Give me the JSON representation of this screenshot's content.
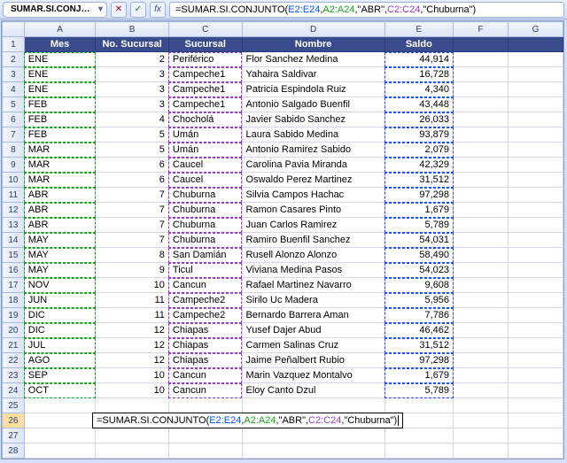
{
  "namebox": {
    "value": "SUMAR.SI.CONJ…",
    "dropdown_glyph": "▾"
  },
  "fx_buttons": {
    "cancel": "✕",
    "ok": "✓",
    "fx": "fx"
  },
  "formula": {
    "prefix": "=SUMAR.SI.CONJUNTO(",
    "r1": "E2:E24",
    "c1": ",",
    "r2": "A2:A24",
    "c2": ",\"ABR\",",
    "r3": "C2:C24",
    "c3": ",\"Chuburna\")"
  },
  "columns": [
    "",
    "A",
    "B",
    "C",
    "D",
    "E",
    "F",
    "G"
  ],
  "header_row": {
    "num": "1",
    "mes": "Mes",
    "no": "No. Sucursal",
    "suc": "Sucursal",
    "nom": "Nombre",
    "saldo": "Saldo"
  },
  "rows": [
    {
      "n": "2",
      "mes": "ENE",
      "no": "2",
      "suc": "Periférico",
      "nom": "Flor Sanchez Medina",
      "saldo": "44,914"
    },
    {
      "n": "3",
      "mes": "ENE",
      "no": "3",
      "suc": "Campeche1",
      "nom": "Yahaira Saldivar",
      "saldo": "16,728"
    },
    {
      "n": "4",
      "mes": "ENE",
      "no": "3",
      "suc": "Campeche1",
      "nom": "Patricia Espindola Ruiz",
      "saldo": "4,340"
    },
    {
      "n": "5",
      "mes": "FEB",
      "no": "3",
      "suc": "Campeche1",
      "nom": "Antonio Salgado Buenfil",
      "saldo": "43,448"
    },
    {
      "n": "6",
      "mes": "FEB",
      "no": "4",
      "suc": "Chocholá",
      "nom": "Javier Sabido Sanchez",
      "saldo": "26,033"
    },
    {
      "n": "7",
      "mes": "FEB",
      "no": "5",
      "suc": "Umán",
      "nom": "Laura Sabido Medina",
      "saldo": "93,879"
    },
    {
      "n": "8",
      "mes": "MAR",
      "no": "5",
      "suc": "Umán",
      "nom": "Antonio Ramirez Sabido",
      "saldo": "2,079"
    },
    {
      "n": "9",
      "mes": "MAR",
      "no": "6",
      "suc": "Caucel",
      "nom": "Carolina Pavia Miranda",
      "saldo": "42,329"
    },
    {
      "n": "10",
      "mes": "MAR",
      "no": "6",
      "suc": "Caucel",
      "nom": "Oswaldo Perez Martinez",
      "saldo": "31,512"
    },
    {
      "n": "11",
      "mes": "ABR",
      "no": "7",
      "suc": "Chuburna",
      "nom": "Silvia Campos Hachac",
      "saldo": "97,298"
    },
    {
      "n": "12",
      "mes": "ABR",
      "no": "7",
      "suc": "Chuburna",
      "nom": "Ramon Casares Pinto",
      "saldo": "1,679"
    },
    {
      "n": "13",
      "mes": "ABR",
      "no": "7",
      "suc": "Chuburna",
      "nom": "Juan Carlos Ramirez",
      "saldo": "5,789"
    },
    {
      "n": "14",
      "mes": "MAY",
      "no": "7",
      "suc": "Chuburna",
      "nom": "Ramiro Buenfil Sanchez",
      "saldo": "54,031"
    },
    {
      "n": "15",
      "mes": "MAY",
      "no": "8",
      "suc": "San Damián",
      "nom": "Rusell Alonzo Alonzo",
      "saldo": "58,490"
    },
    {
      "n": "16",
      "mes": "MAY",
      "no": "9",
      "suc": "Ticul",
      "nom": "Viviana Medina Pasos",
      "saldo": "54,023"
    },
    {
      "n": "17",
      "mes": "NOV",
      "no": "10",
      "suc": "Cancun",
      "nom": "Rafael Martinez Navarro",
      "saldo": "9,608"
    },
    {
      "n": "18",
      "mes": "JUN",
      "no": "11",
      "suc": "Campeche2",
      "nom": "Sirilo Uc Madera",
      "saldo": "5,956"
    },
    {
      "n": "19",
      "mes": "DIC",
      "no": "11",
      "suc": "Campeche2",
      "nom": "Bernardo Barrera Aman",
      "saldo": "7,786"
    },
    {
      "n": "20",
      "mes": "DIC",
      "no": "12",
      "suc": "Chiapas",
      "nom": "Yusef Dajer Abud",
      "saldo": "46,462"
    },
    {
      "n": "21",
      "mes": "JUL",
      "no": "12",
      "suc": "Chiapas",
      "nom": "Carmen Salinas Cruz",
      "saldo": "31,512"
    },
    {
      "n": "22",
      "mes": "AGO",
      "no": "12",
      "suc": "Chiapas",
      "nom": "Jaime Peñalbert Rubio",
      "saldo": "97,298"
    },
    {
      "n": "23",
      "mes": "SEP",
      "no": "10",
      "suc": "Cancun",
      "nom": "Marin Vazquez Montalvo",
      "saldo": "1,679"
    },
    {
      "n": "24",
      "mes": "OCT",
      "no": "10",
      "suc": "Cancun",
      "nom": "Eloy Canto Dzul",
      "saldo": "5,789"
    }
  ],
  "empty_rows": [
    "25",
    "26",
    "27",
    "28"
  ],
  "active_row": "26",
  "col_widths": {
    "A": 78,
    "B": 80,
    "C": 80,
    "D": 156,
    "E": 75,
    "F": 60,
    "G": 60
  }
}
